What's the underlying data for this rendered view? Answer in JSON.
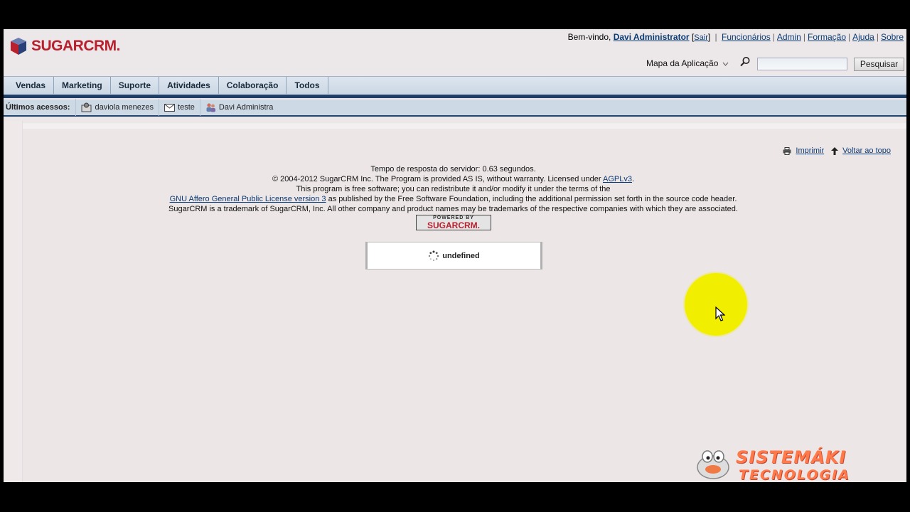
{
  "brand": {
    "logo_text": "SUGARCRM."
  },
  "header": {
    "welcome_prefix": "Bem-vindo,",
    "user_name": "Davi Administrator",
    "logout_open": "[",
    "logout_label": "Sair",
    "logout_close": "]",
    "links": [
      "Funcionários",
      "Admin",
      "Formação",
      "Ajuda",
      "Sobre"
    ],
    "sitemap_label": "Mapa da Aplicação",
    "search_placeholder": "",
    "search_button": "Pesquisar"
  },
  "nav": {
    "tabs": [
      "Vendas",
      "Marketing",
      "Suporte",
      "Atividades",
      "Colaboração",
      "Todos"
    ]
  },
  "last_viewed": {
    "label": "Últimos acessos:",
    "items": [
      {
        "label": "daviola menezes",
        "icon": "contact-icon"
      },
      {
        "label": "teste",
        "icon": "email-icon"
      },
      {
        "label": "Davi Administra",
        "icon": "users-icon"
      }
    ]
  },
  "page_actions": {
    "print_label": "Imprimir",
    "top_label": "Voltar ao topo"
  },
  "footer": {
    "response_time": "Tempo de resposta do servidor: 0.63 segundos.",
    "copyright_pre": "© 2004-2012 SugarCRM Inc. The Program is provided AS IS, without warranty. Licensed under ",
    "agpl_link": "AGPLv3",
    "copyright_post": ".",
    "free_software": "This program is free software; you can redistribute it and/or modify it under the terms of the",
    "gnu_link": "GNU Affero General Public License version 3",
    "gnu_post": " as published by the Free Software Foundation, including the additional permission set forth in the source code header.",
    "trademark": "SugarCRM is a trademark of SugarCRM, Inc. All other company and product names may be trademarks of the respective companies with which they are associated.",
    "powered_by": "POWERED BY",
    "powered_brand": "SUGARCRM."
  },
  "loading": {
    "text": "undefined"
  },
  "watermark": {
    "line1": "SISTEMÁKI",
    "line2": "TECNOLOGIA"
  },
  "colors": {
    "brand_red": "#b8202d",
    "nav_dark": "#1f3f69",
    "link": "#0b3a73",
    "highlight": "#f2ee00"
  }
}
